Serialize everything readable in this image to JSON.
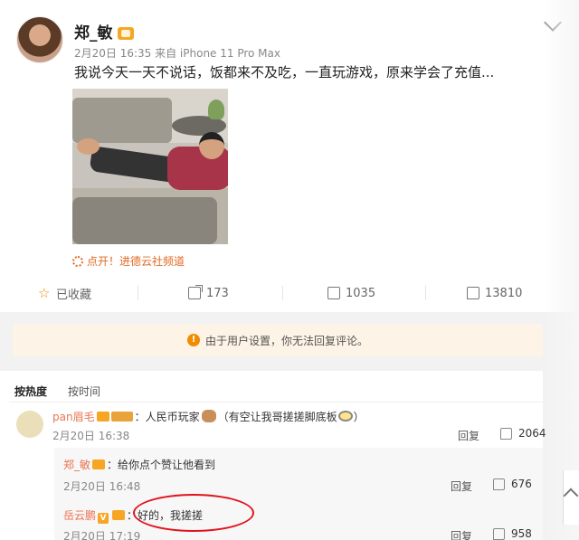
{
  "post": {
    "author": "郑_敏",
    "meta": "2月20日 16:35 来自 iPhone 11 Pro Max",
    "text": "我说今天一天不说话，饭都来不及吃，一直玩游戏，原来学会了充值...",
    "channel_link": "点开！进德云社频道",
    "actions": {
      "favorite": "已收藏",
      "share": "173",
      "comment": "1035",
      "like": "13810"
    },
    "icons": {
      "favorite": "star-icon",
      "share": "share-icon",
      "comment": "comment-icon",
      "like": "thumbs-up-icon",
      "more": "chevron-down-icon"
    }
  },
  "notice": {
    "text": "由于用户设置，你无法回复评论。",
    "icon": "warning-icon",
    "background": "#fdf3e6"
  },
  "sort_tabs": [
    "按热度",
    "按时间"
  ],
  "comments": [
    {
      "name": "pan眉毛",
      "text_a": "：人民币玩家",
      "text_b": "（有空让我哥搓搓脚底板",
      "text_c": "）",
      "time": "2月20日 16:38",
      "reply": "回复",
      "likes": "2064"
    }
  ],
  "replies": [
    {
      "name": "郑_敏",
      "text": "：给你点个赞让他看到",
      "time": "2月20日 16:48",
      "reply": "回复",
      "likes": "676"
    },
    {
      "name": "岳云鹏",
      "text": "：好的，我搓搓",
      "time": "2月20日 17:19",
      "reply": "回复",
      "likes": "958"
    }
  ],
  "colors": {
    "accent": "#eb7350",
    "highlight_circle": "#e0141e",
    "vip": "#f6a623"
  }
}
